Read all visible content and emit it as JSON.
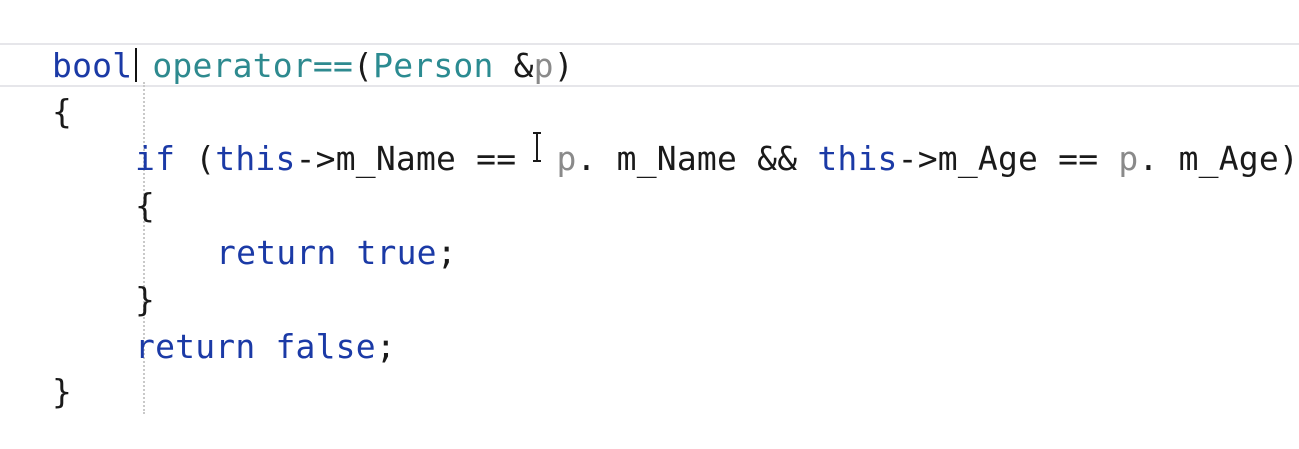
{
  "code": {
    "line1": {
      "kw_bool": "bool",
      "fn_operator": "operator==",
      "paren_open": "(",
      "type_person": "Person",
      "amp": " &",
      "param_p": "p",
      "paren_close": ")"
    },
    "line2": {
      "brace": "{"
    },
    "line3": {
      "kw_if": "if",
      "open": " (",
      "kw_this1": "this",
      "arrow1": "->m_Name ==",
      "param_p1": "p",
      "mid": ". m_Name && ",
      "kw_this2": "this",
      "arrow2": "->m_Age == ",
      "param_p2": "p",
      "tail": ". m_Age)"
    },
    "line4": {
      "brace": "{"
    },
    "line5": {
      "kw_return": "return",
      "kw_true": "true",
      "semi": ";"
    },
    "line6": {
      "brace": "}"
    },
    "line7": {
      "kw_return": "return",
      "kw_false": "false",
      "semi": ";"
    },
    "line8": {
      "brace": "}"
    }
  },
  "colors": {
    "keyword": "#1b3aa6",
    "function": "#2e8a8f",
    "type": "#2b8b91",
    "parameter": "#8a8a8a",
    "plain": "#1a1a1a",
    "current_line_border": "#e6e6ea"
  },
  "icons": {
    "text_cursor": "text-caret",
    "mouse_cursor": "i-beam-cursor"
  }
}
